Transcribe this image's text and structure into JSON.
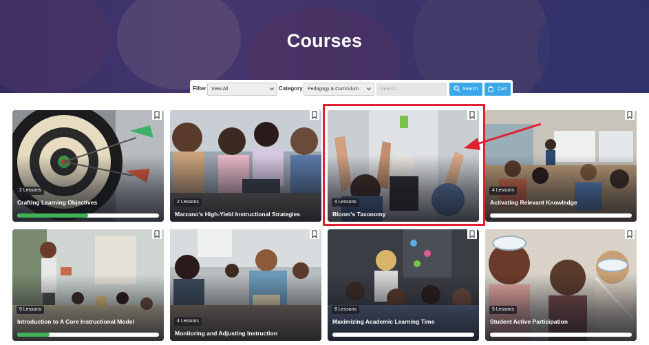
{
  "page": {
    "title": "Courses"
  },
  "filter": {
    "filter_label": "Filter",
    "filter_value": "View All",
    "category_label": "Category",
    "category_value": "Pedagogy & Curriculum",
    "search_placeholder": "Search...",
    "search_button": "Search",
    "cart_button": "Cart"
  },
  "colors": {
    "accent": "#3aa7e8",
    "progress": "#3fb157",
    "highlight": "#e02030"
  },
  "courses": [
    {
      "title": "Crafting Learning Objectives",
      "lessons": "2 Lessons",
      "progress": 0.5,
      "photo": "dartboard"
    },
    {
      "title": "Marzano's High-Yield Instructional Strategies",
      "lessons": "2 Lessons",
      "progress": null,
      "photo": "kids-table"
    },
    {
      "title": "Bloom's Taxonomy",
      "lessons": "4 Lessons",
      "progress": null,
      "photo": "raised-hands"
    },
    {
      "title": "Activating Relevant Knowledge",
      "lessons": "4 Lessons",
      "progress": 0,
      "photo": "classroom-back"
    },
    {
      "title": "Introduction to A Core Instructional Model",
      "lessons": "5 Lessons",
      "progress": 0.23,
      "photo": "teacher-reading"
    },
    {
      "title": "Monitoring and Adjusting Instruction",
      "lessons": "4 Lessons",
      "progress": null,
      "photo": "teacher-helping"
    },
    {
      "title": "Maximizing Academic Learning Time",
      "lessons": "6 Lessons",
      "progress": 0,
      "photo": "teacher-group"
    },
    {
      "title": "Student Active Participation",
      "lessons": "5 Lessons",
      "progress": 0,
      "photo": "goggles-kids"
    }
  ]
}
